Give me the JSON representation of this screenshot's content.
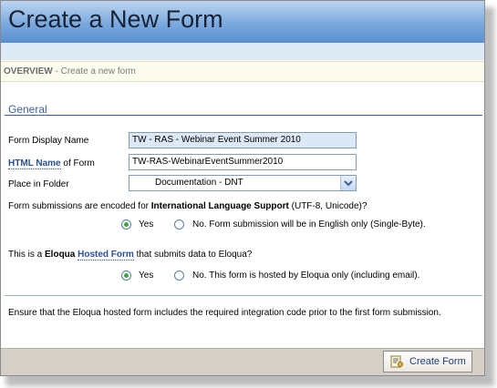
{
  "window": {
    "title": "Create a New Form"
  },
  "overview": {
    "prefix": "OVERVIEW",
    "separator": " - ",
    "text": "Create a new form"
  },
  "general": {
    "heading": "General",
    "display_name_label": "Form Display Name",
    "display_name_value": "TW - RAS - Webinar Event Summer 2010",
    "html_name_link": "HTML Name",
    "html_name_suffix": " of Form",
    "html_name_value": "TW-RAS-WebinarEventSummer2010",
    "folder_label": "Place in Folder",
    "folder_value": "Documentation - DNT"
  },
  "encoding": {
    "question_prefix": "Form submissions are encoded for ",
    "question_bold": "International Language Support",
    "question_suffix": " (UTF-8, Unicode)?",
    "yes_label": "Yes",
    "no_label": "No. Form submission will be in English only (Single-Byte).",
    "selected": "yes"
  },
  "hosted": {
    "question_prefix": "This is a ",
    "question_bold": "Eloqua",
    "question_link": "Hosted Form",
    "question_suffix": " that submits data to Eloqua?",
    "yes_label": "Yes",
    "no_label": "No. This form is hosted by Eloqua only (including email).",
    "selected": "yes"
  },
  "notice": "Ensure that the Eloqua hosted form includes the required integration code prior to the first form submission.",
  "footer": {
    "create_label": "Create Form"
  },
  "colors": {
    "title_gradient": "#7aa9de",
    "link": "#2a4f99",
    "radio_dot": "#3bab3b"
  }
}
